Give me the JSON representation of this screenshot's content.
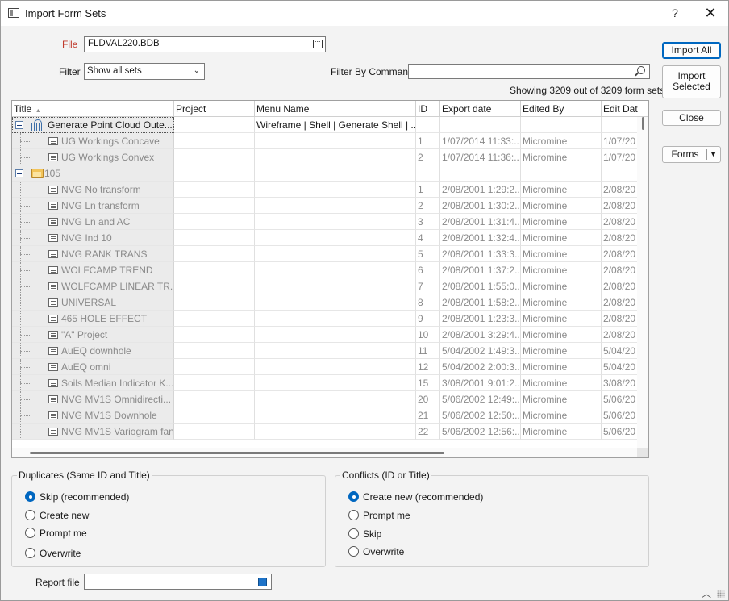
{
  "window": {
    "title": "Import Form Sets",
    "help_label": "?",
    "close_label": "✕"
  },
  "file": {
    "label": "File",
    "value": "FLDVAL220.BDB"
  },
  "filter": {
    "label": "Filter",
    "selected": "Show all sets"
  },
  "filter_by_command": {
    "label": "Filter By Command",
    "value": ""
  },
  "showing": "Showing 3209 out of 3209 form sets",
  "buttons": {
    "import_all": "Import All",
    "import_selected_1": "Import",
    "import_selected_2": "Selected",
    "close": "Close",
    "forms": "Forms"
  },
  "grid": {
    "columns": [
      "Title",
      "Project",
      "Menu Name",
      "ID",
      "Export date",
      "Edited By",
      "Edit Dat"
    ],
    "rows": [
      {
        "kind": "parent",
        "title": "Generate Point Cloud Oute...",
        "project": "",
        "menu": "Wireframe | Shell | Generate Shell | ...",
        "id": "",
        "export": "",
        "edited": "",
        "edit": ""
      },
      {
        "kind": "child",
        "title": "UG Workings Concave",
        "project": "",
        "menu": "",
        "id": "1",
        "export": "1/07/2014 11:33:...",
        "edited": "Micromine",
        "edit": "1/07/20"
      },
      {
        "kind": "child",
        "title": "UG Workings Convex",
        "project": "",
        "menu": "",
        "id": "2",
        "export": "1/07/2014 11:36:...",
        "edited": "Micromine",
        "edit": "1/07/20"
      },
      {
        "kind": "folder",
        "title": "105",
        "project": "",
        "menu": "",
        "id": "",
        "export": "",
        "edited": "",
        "edit": ""
      },
      {
        "kind": "child",
        "title": "NVG No transform",
        "project": "",
        "menu": "",
        "id": "1",
        "export": "2/08/2001 1:29:2...",
        "edited": "Micromine",
        "edit": "2/08/20"
      },
      {
        "kind": "child",
        "title": "NVG Ln transform",
        "project": "",
        "menu": "",
        "id": "2",
        "export": "2/08/2001 1:30:2...",
        "edited": "Micromine",
        "edit": "2/08/20"
      },
      {
        "kind": "child",
        "title": "NVG Ln and AC",
        "project": "",
        "menu": "",
        "id": "3",
        "export": "2/08/2001 1:31:4...",
        "edited": "Micromine",
        "edit": "2/08/20"
      },
      {
        "kind": "child",
        "title": "NVG Ind 10",
        "project": "",
        "menu": "",
        "id": "4",
        "export": "2/08/2001 1:32:4...",
        "edited": "Micromine",
        "edit": "2/08/20"
      },
      {
        "kind": "child",
        "title": "NVG RANK TRANS",
        "project": "",
        "menu": "",
        "id": "5",
        "export": "2/08/2001 1:33:3...",
        "edited": "Micromine",
        "edit": "2/08/20"
      },
      {
        "kind": "child",
        "title": "WOLFCAMP TREND",
        "project": "",
        "menu": "",
        "id": "6",
        "export": "2/08/2001 1:37:2...",
        "edited": "Micromine",
        "edit": "2/08/20"
      },
      {
        "kind": "child",
        "title": "WOLFCAMP LINEAR TR...",
        "project": "",
        "menu": "",
        "id": "7",
        "export": "2/08/2001 1:55:0...",
        "edited": "Micromine",
        "edit": "2/08/20"
      },
      {
        "kind": "child",
        "title": "UNIVERSAL",
        "project": "",
        "menu": "",
        "id": "8",
        "export": "2/08/2001 1:58:2...",
        "edited": "Micromine",
        "edit": "2/08/20"
      },
      {
        "kind": "child",
        "title": "465 HOLE EFFECT",
        "project": "",
        "menu": "",
        "id": "9",
        "export": "2/08/2001 1:23:3...",
        "edited": "Micromine",
        "edit": "2/08/20"
      },
      {
        "kind": "child",
        "title": "\"A\" Project",
        "project": "",
        "menu": "",
        "id": "10",
        "export": "2/08/2001 3:29:4...",
        "edited": "Micromine",
        "edit": "2/08/20"
      },
      {
        "kind": "child",
        "title": "AuEQ downhole",
        "project": "",
        "menu": "",
        "id": "11",
        "export": "5/04/2002 1:49:3...",
        "edited": "Micromine",
        "edit": "5/04/20"
      },
      {
        "kind": "child",
        "title": "AuEQ omni",
        "project": "",
        "menu": "",
        "id": "12",
        "export": "5/04/2002 2:00:3...",
        "edited": "Micromine",
        "edit": "5/04/20"
      },
      {
        "kind": "child",
        "title": "Soils Median Indicator K...",
        "project": "",
        "menu": "",
        "id": "15",
        "export": "3/08/2001 9:01:2...",
        "edited": "Micromine",
        "edit": "3/08/20"
      },
      {
        "kind": "child",
        "title": "NVG MV1S Omnidirecti...",
        "project": "",
        "menu": "",
        "id": "20",
        "export": "5/06/2002 12:49:...",
        "edited": "Micromine",
        "edit": "5/06/20"
      },
      {
        "kind": "child",
        "title": "NVG MV1S Downhole",
        "project": "",
        "menu": "",
        "id": "21",
        "export": "5/06/2002 12:50:...",
        "edited": "Micromine",
        "edit": "5/06/20"
      },
      {
        "kind": "child",
        "title": "NVG MV1S Variogram fan",
        "project": "",
        "menu": "",
        "id": "22",
        "export": "5/06/2002 12:56:...",
        "edited": "Micromine",
        "edit": "5/06/20"
      }
    ]
  },
  "duplicates": {
    "title": "Duplicates (Same ID and Title)",
    "options": [
      "Skip (recommended)",
      "Create new",
      "Prompt me",
      "Overwrite"
    ],
    "selected": 0
  },
  "conflicts": {
    "title": "Conflicts (ID or Title)",
    "options": [
      "Create new (recommended)",
      "Prompt me",
      "Skip",
      "Overwrite"
    ],
    "selected": 0
  },
  "report_file": {
    "label": "Report file",
    "value": ""
  },
  "footer": {
    "collapse_label": "︿"
  }
}
